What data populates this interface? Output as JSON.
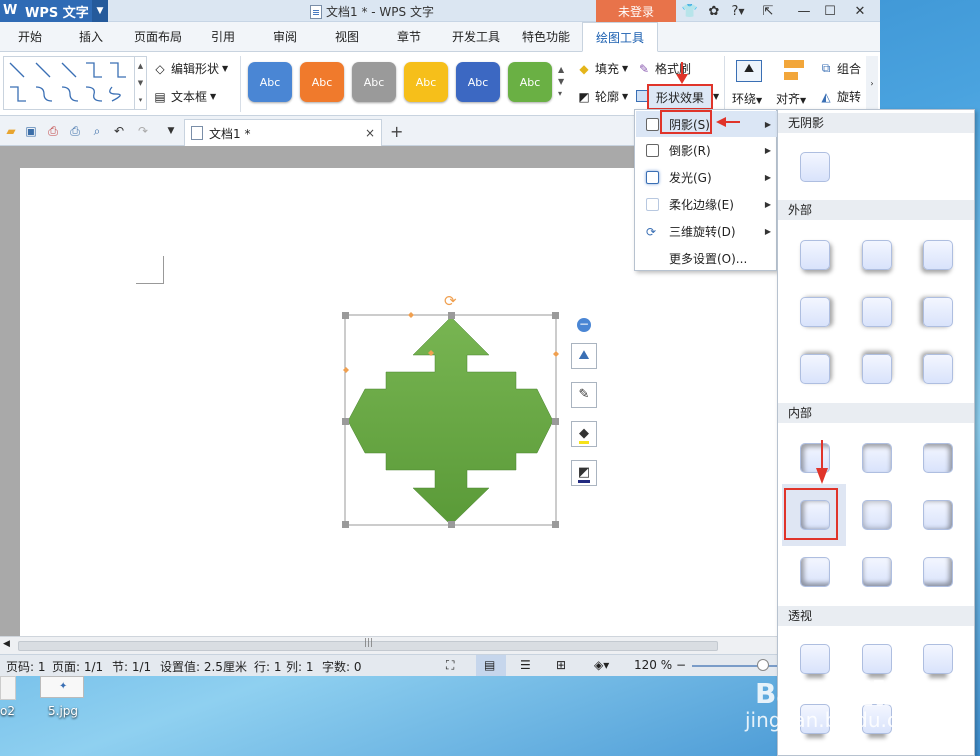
{
  "titlebar": {
    "app_name": "WPS 文字",
    "doc_title": "文档1 * - WPS 文字",
    "login": "未登录",
    "help": "?"
  },
  "tabs": [
    "开始",
    "插入",
    "页面布局",
    "引用",
    "审阅",
    "视图",
    "章节",
    "开发工具",
    "特色功能",
    "绘图工具"
  ],
  "active_tab": "绘图工具",
  "ribbon": {
    "edit_shape": "编辑形状",
    "text_box": "文本框",
    "style_buttons": [
      {
        "label": "Abc",
        "color": "#4a86d4"
      },
      {
        "label": "Abc",
        "color": "#f07a2c"
      },
      {
        "label": "Abc",
        "color": "#9a9a9a"
      },
      {
        "label": "Abc",
        "color": "#f6bf1a"
      },
      {
        "label": "Abc",
        "color": "#3c68c2"
      },
      {
        "label": "Abc",
        "color": "#6ab044"
      }
    ],
    "fill": "填充",
    "format_painter": "格式刷",
    "outline": "轮廓",
    "shape_effect": "形状效果",
    "wrap": "环绕",
    "align": "对齐",
    "group": "组合",
    "rotate": "旋转"
  },
  "doc_tab": {
    "title": "文档1 *",
    "close": "×",
    "new": "+"
  },
  "status": {
    "page_code": "页码: 1",
    "page": "页面: 1/1",
    "section": "节: 1/1",
    "setting": "设置值: 2.5厘米",
    "row": "行: 1",
    "col": "列: 1",
    "words": "字数: 0",
    "zoom": "120 %"
  },
  "effect_menu": [
    {
      "label": "阴影(S)",
      "has_sub": true,
      "highlighted": true
    },
    {
      "label": "倒影(R)",
      "has_sub": true,
      "highlighted": false
    },
    {
      "label": "发光(G)",
      "has_sub": true,
      "highlighted": false
    },
    {
      "label": "柔化边缘(E)",
      "has_sub": true,
      "highlighted": false
    },
    {
      "label": "三维旋转(D)",
      "has_sub": true,
      "highlighted": false
    },
    {
      "label": "更多设置(O)...",
      "has_sub": false,
      "highlighted": false
    }
  ],
  "shadow_panel": {
    "no_shadow": "无阴影",
    "outer": "外部",
    "inner": "内部",
    "perspective": "透视",
    "selected": "inner-row2-col1"
  },
  "desktop": {
    "file1": "5.jpg",
    "file0": "o2"
  },
  "shape": {
    "color": "#6aa844",
    "type": "four-way-arrow"
  },
  "watermark": {
    "line1": "Baidu经验",
    "line2": "jingyan.baidu.com"
  }
}
